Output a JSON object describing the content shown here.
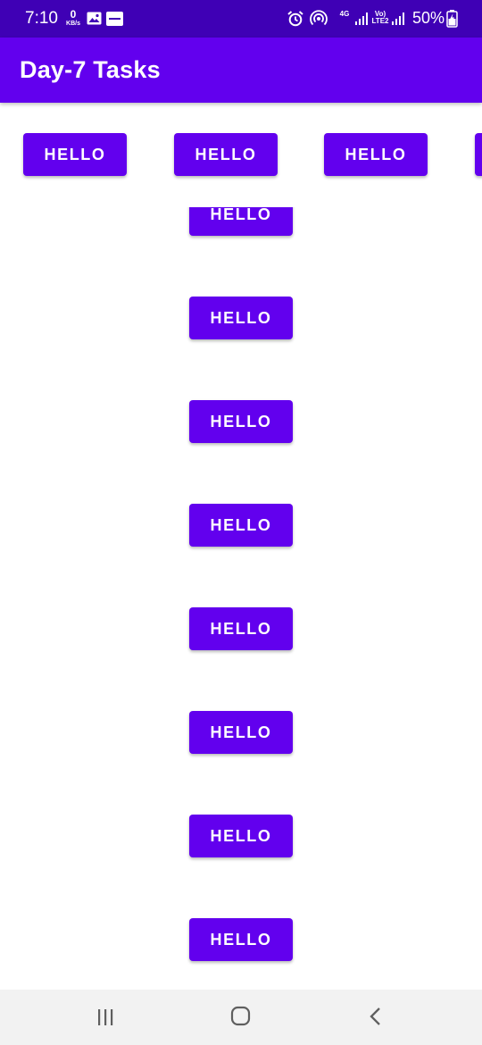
{
  "status_bar": {
    "time": "7:10",
    "net_speed_value": "0",
    "net_speed_unit": "KB/s",
    "net_type_1": "4G",
    "net_type_2": "Vo) LTE2",
    "battery": "50%"
  },
  "app_bar": {
    "title": "Day-7 Tasks"
  },
  "horizontal_buttons": [
    {
      "label": "HELLO"
    },
    {
      "label": "HELLO"
    },
    {
      "label": "HELLO"
    },
    {
      "label": ""
    }
  ],
  "vertical_buttons": [
    {
      "label": "HELLO"
    },
    {
      "label": "HELLO"
    },
    {
      "label": "HELLO"
    },
    {
      "label": "HELLO"
    },
    {
      "label": "HELLO"
    },
    {
      "label": "HELLO"
    },
    {
      "label": "HELLO"
    },
    {
      "label": "HELLO"
    }
  ],
  "colors": {
    "status_bar": "#3f00b5",
    "primary": "#6200ee",
    "on_primary": "#ffffff",
    "nav_bar": "#f2f2f2"
  },
  "nav_icons": [
    "recents-icon",
    "home-icon",
    "back-icon"
  ]
}
